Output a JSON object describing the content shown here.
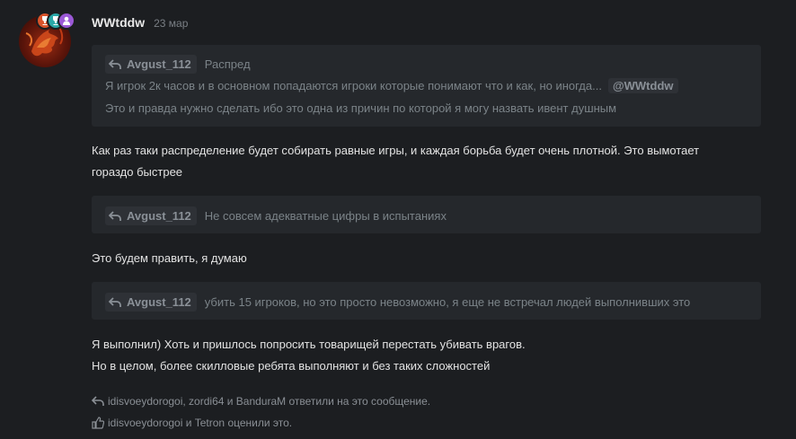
{
  "post": {
    "author": "WWtddw",
    "date": "23 мар",
    "quotes": [
      {
        "name": "Avgust_112",
        "head_text": "Распред",
        "line1": "Я игрок 2к часов и в основном попадаются игроки которые понимают что и как, но иногда...",
        "mention": "@WWtddw",
        "line2": "Это и правда нужно сделать ибо это одна из причин по которой я могу назвать ивент душным"
      },
      {
        "name": "Avgust_112",
        "head_text": "Не совсем адекватные цифры в испытаниях"
      },
      {
        "name": "Avgust_112",
        "head_text": "убить 15 игроков, но это просто невозможно, я еще не встречал людей выполнивших это"
      }
    ],
    "paragraphs": {
      "p1_line1": "Как раз таки распределение будет собирать равные игры, и каждая борьба будет очень плотной. Это вымотает",
      "p1_line2": "гораздо быстрее",
      "p2": "Это будем править, я думаю",
      "p3_line1": "Я выполнил) Хоть и пришлось попросить товарищей перестать убивать врагов.",
      "p3_line2": "Но в целом, более скилловые ребята выполняют и без таких сложностей"
    },
    "footer": {
      "replies": "idisvoeydorogoi, zordi64 и BanduraM ответили на это сообщение.",
      "likes": "idisvoeydorogoi и Tetron оценили это."
    },
    "icons": {
      "reply": "reply-arrow-icon",
      "like": "thumbs-up-icon",
      "badges": [
        "trophy-badge-icon",
        "trophy-badge-icon",
        "user-badge-icon"
      ]
    },
    "colors": {
      "background": "#1c1e21",
      "quote_bg": "#25282c",
      "badge1": "#d9542b",
      "badge2": "#2aa8a8",
      "badge3": "#9b59d6"
    }
  }
}
